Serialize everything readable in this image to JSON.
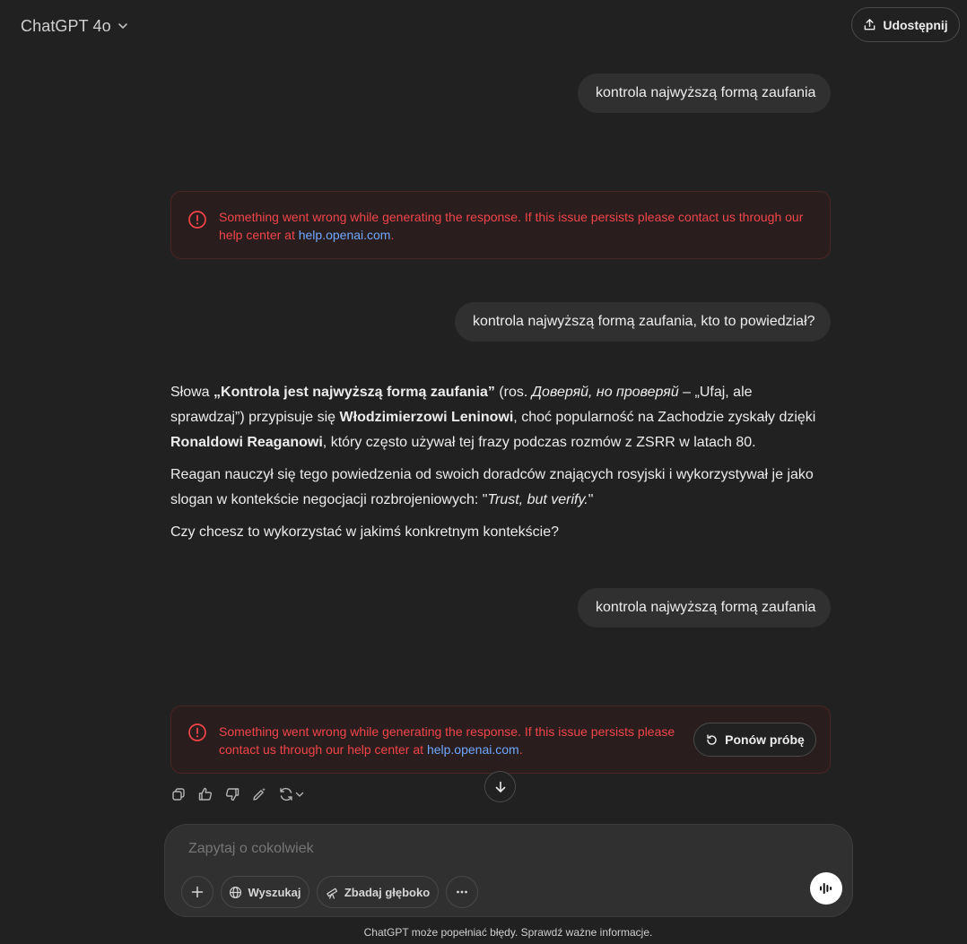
{
  "header": {
    "model_name": "ChatGPT 4o",
    "share_label": "Udostępnij"
  },
  "messages": {
    "user1": "kontrola najwyższą formą zaufania",
    "error1": {
      "text": "Something went wrong while generating the response. If this issue persists please contact us through our help center at ",
      "link": "help.openai.com",
      "tail": "."
    },
    "user2": "kontrola najwyższą formą zaufania, kto to powiedział?",
    "assistant": {
      "p1_a": "Słowa ",
      "p1_quote": "„Kontrola jest najwyższą formą zaufania”",
      "p1_b": " (ros. ",
      "p1_ru": "Доверяй, но проверяй",
      "p1_c": " – „Ufaj, ale sprawdzaj”) przypisuje się ",
      "p1_lenin": "Włodzimierzowi Leninowi",
      "p1_d": ", choć popularność na Zachodzie zyskały dzięki ",
      "p1_reagan": "Ronaldowi Reaganowi",
      "p1_e": ", który często używał tej frazy podczas rozmów z ZSRR w latach 80.",
      "p2_a": "Reagan nauczył się tego powiedzenia od swoich doradców znających rosyjski i wykorzystywał je jako slogan w kontekście negocjacji rozbrojeniowych: \"",
      "p2_quote": "Trust, but verify.",
      "p2_b": "\"",
      "p3": "Czy chcesz to wykorzystać w jakimś konkretnym kontekście?"
    },
    "user3": "kontrola najwyższą formą zaufania",
    "error2": {
      "text": "Something went wrong while generating the response. If this issue persists please contact us through our help center at ",
      "link": "help.openai.com",
      "tail": ".",
      "retry_label": "Ponów próbę"
    }
  },
  "composer": {
    "placeholder": "Zapytaj o cokolwiek",
    "search_label": "Wyszukaj",
    "deep_label": "Zbadaj głęboko"
  },
  "footer": "ChatGPT może popełniać błędy. Sprawdź ważne informacje.",
  "colors": {
    "background": "#212121",
    "bubble": "#303030",
    "error_text": "#f0454a",
    "link": "#6ea8ff"
  }
}
